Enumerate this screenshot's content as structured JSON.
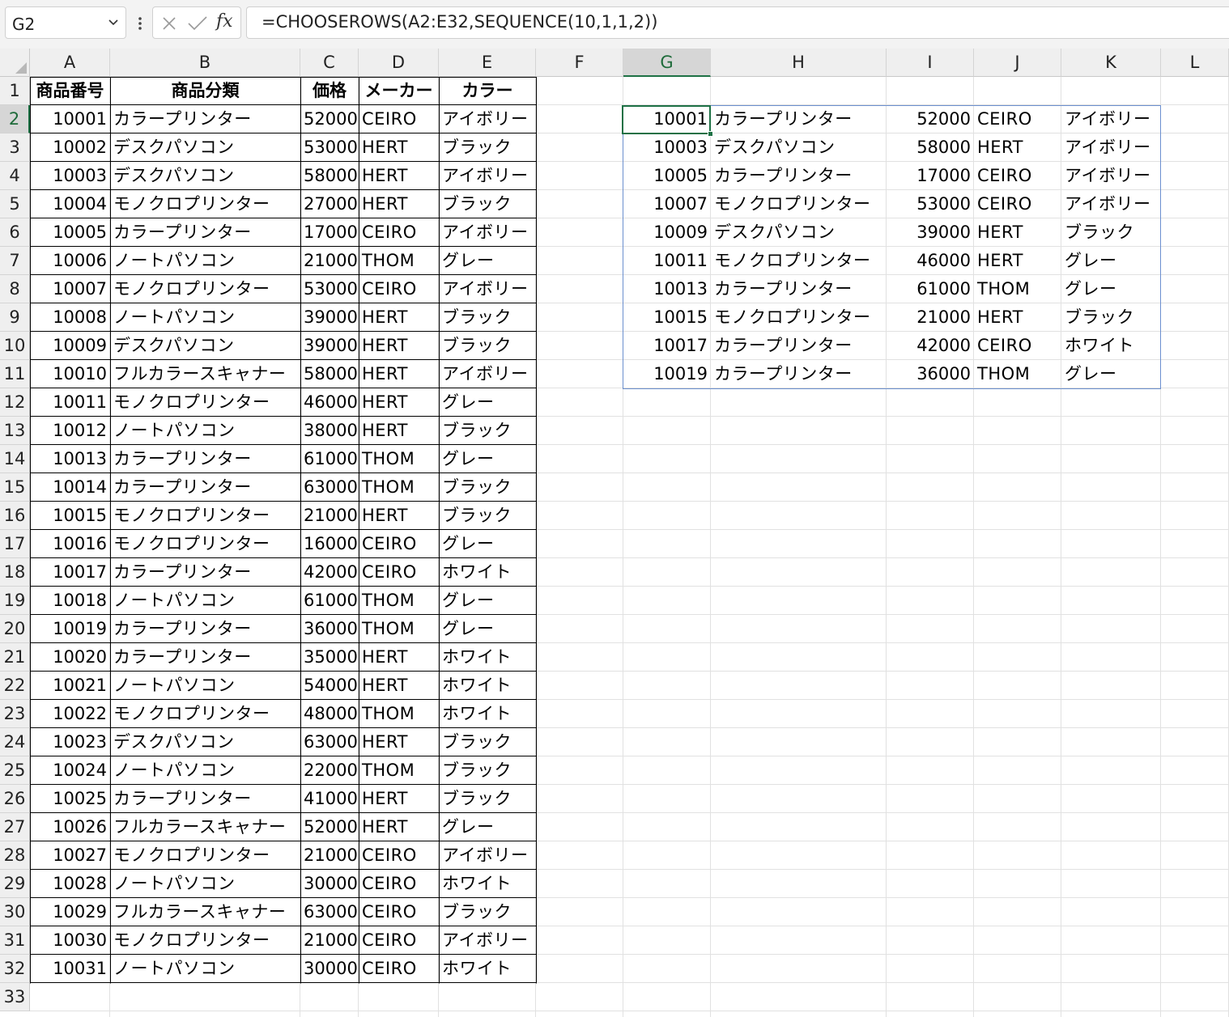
{
  "formula_bar": {
    "name_box": "G2",
    "formula": "=CHOOSEROWS(A2:E32,SEQUENCE(10,1,1,2))",
    "fx_label": "fx"
  },
  "columns": [
    "A",
    "B",
    "C",
    "D",
    "E",
    "F",
    "G",
    "H",
    "I",
    "J",
    "K",
    "L"
  ],
  "selected_column": "G",
  "selected_row": 2,
  "row_numbers": [
    1,
    2,
    3,
    4,
    5,
    6,
    7,
    8,
    9,
    10,
    11,
    12,
    13,
    14,
    15,
    16,
    17,
    18,
    19,
    20,
    21,
    22,
    23,
    24,
    25,
    26,
    27,
    28,
    29,
    30,
    31,
    32,
    33
  ],
  "source_table": {
    "headers": [
      "商品番号",
      "商品分類",
      "価格",
      "メーカー",
      "カラー"
    ],
    "rows": [
      [
        "10001",
        "カラープリンター",
        "52000",
        "CEIRO",
        "アイボリー"
      ],
      [
        "10002",
        "デスクパソコン",
        "53000",
        "HERT",
        "ブラック"
      ],
      [
        "10003",
        "デスクパソコン",
        "58000",
        "HERT",
        "アイボリー"
      ],
      [
        "10004",
        "モノクロプリンター",
        "27000",
        "HERT",
        "ブラック"
      ],
      [
        "10005",
        "カラープリンター",
        "17000",
        "CEIRO",
        "アイボリー"
      ],
      [
        "10006",
        "ノートパソコン",
        "21000",
        "THOM",
        "グレー"
      ],
      [
        "10007",
        "モノクロプリンター",
        "53000",
        "CEIRO",
        "アイボリー"
      ],
      [
        "10008",
        "ノートパソコン",
        "39000",
        "HERT",
        "ブラック"
      ],
      [
        "10009",
        "デスクパソコン",
        "39000",
        "HERT",
        "ブラック"
      ],
      [
        "10010",
        "フルカラースキャナー",
        "58000",
        "HERT",
        "アイボリー"
      ],
      [
        "10011",
        "モノクロプリンター",
        "46000",
        "HERT",
        "グレー"
      ],
      [
        "10012",
        "ノートパソコン",
        "38000",
        "HERT",
        "ブラック"
      ],
      [
        "10013",
        "カラープリンター",
        "61000",
        "THOM",
        "グレー"
      ],
      [
        "10014",
        "カラープリンター",
        "63000",
        "THOM",
        "ブラック"
      ],
      [
        "10015",
        "モノクロプリンター",
        "21000",
        "HERT",
        "ブラック"
      ],
      [
        "10016",
        "モノクロプリンター",
        "16000",
        "CEIRO",
        "グレー"
      ],
      [
        "10017",
        "カラープリンター",
        "42000",
        "CEIRO",
        "ホワイト"
      ],
      [
        "10018",
        "ノートパソコン",
        "61000",
        "THOM",
        "グレー"
      ],
      [
        "10019",
        "カラープリンター",
        "36000",
        "THOM",
        "グレー"
      ],
      [
        "10020",
        "カラープリンター",
        "35000",
        "HERT",
        "ホワイト"
      ],
      [
        "10021",
        "ノートパソコン",
        "54000",
        "HERT",
        "ホワイト"
      ],
      [
        "10022",
        "モノクロプリンター",
        "48000",
        "THOM",
        "ホワイト"
      ],
      [
        "10023",
        "デスクパソコン",
        "63000",
        "HERT",
        "ブラック"
      ],
      [
        "10024",
        "ノートパソコン",
        "22000",
        "THOM",
        "ブラック"
      ],
      [
        "10025",
        "カラープリンター",
        "41000",
        "HERT",
        "ブラック"
      ],
      [
        "10026",
        "フルカラースキャナー",
        "52000",
        "HERT",
        "グレー"
      ],
      [
        "10027",
        "モノクロプリンター",
        "21000",
        "CEIRO",
        "アイボリー"
      ],
      [
        "10028",
        "ノートパソコン",
        "30000",
        "CEIRO",
        "ホワイト"
      ],
      [
        "10029",
        "フルカラースキャナー",
        "63000",
        "CEIRO",
        "ブラック"
      ],
      [
        "10030",
        "モノクロプリンター",
        "21000",
        "CEIRO",
        "アイボリー"
      ],
      [
        "10031",
        "ノートパソコン",
        "30000",
        "CEIRO",
        "ホワイト"
      ]
    ]
  },
  "result_table": {
    "rows": [
      [
        "10001",
        "カラープリンター",
        "52000",
        "CEIRO",
        "アイボリー"
      ],
      [
        "10003",
        "デスクパソコン",
        "58000",
        "HERT",
        "アイボリー"
      ],
      [
        "10005",
        "カラープリンター",
        "17000",
        "CEIRO",
        "アイボリー"
      ],
      [
        "10007",
        "モノクロプリンター",
        "53000",
        "CEIRO",
        "アイボリー"
      ],
      [
        "10009",
        "デスクパソコン",
        "39000",
        "HERT",
        "ブラック"
      ],
      [
        "10011",
        "モノクロプリンター",
        "46000",
        "HERT",
        "グレー"
      ],
      [
        "10013",
        "カラープリンター",
        "61000",
        "THOM",
        "グレー"
      ],
      [
        "10015",
        "モノクロプリンター",
        "21000",
        "HERT",
        "ブラック"
      ],
      [
        "10017",
        "カラープリンター",
        "42000",
        "CEIRO",
        "ホワイト"
      ],
      [
        "10019",
        "カラープリンター",
        "36000",
        "THOM",
        "グレー"
      ]
    ]
  }
}
